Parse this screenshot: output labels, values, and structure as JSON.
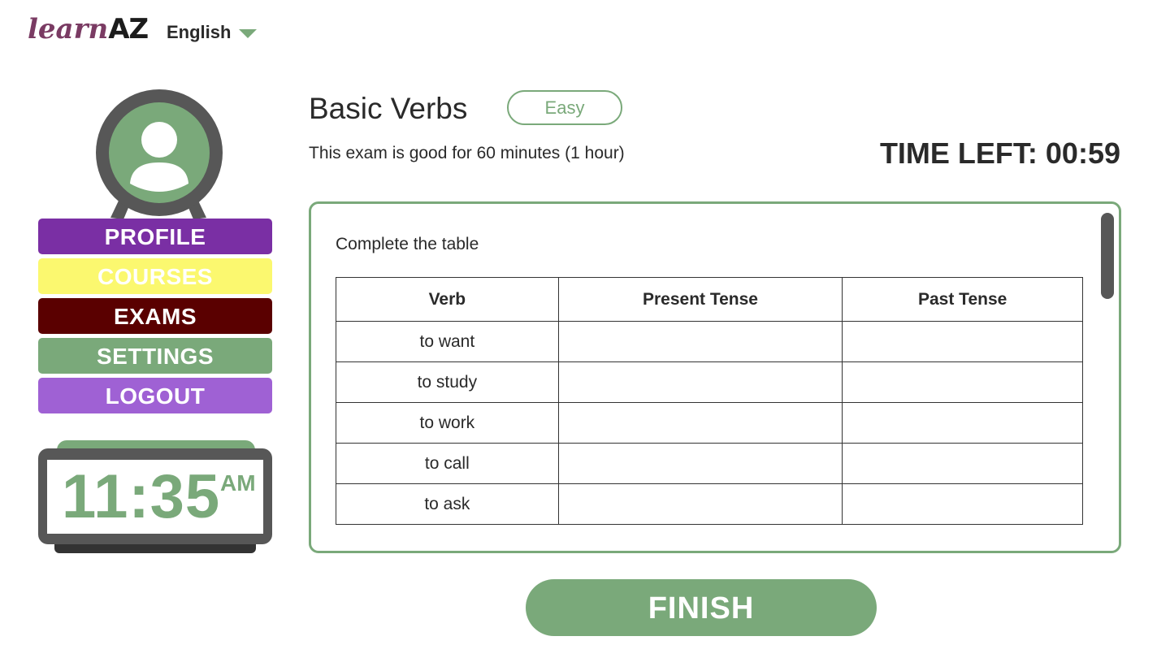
{
  "header": {
    "logo_part1": "learn",
    "logo_part2": "AZ",
    "language": "English"
  },
  "nav": {
    "items": [
      {
        "label": "PROFILE"
      },
      {
        "label": "COURSES"
      },
      {
        "label": "EXAMS"
      },
      {
        "label": "SETTINGS"
      },
      {
        "label": "LOGOUT"
      }
    ]
  },
  "clock": {
    "time": "11:35",
    "period": "AM"
  },
  "exam": {
    "title": "Basic Verbs",
    "difficulty": "Easy",
    "duration_note": "This exam is good for 60 minutes (1 hour)",
    "time_left": "TIME LEFT: 00:59",
    "instructions": "Complete the table",
    "table": {
      "headers": [
        "Verb",
        "Present Tense",
        "Past Tense"
      ],
      "rows": [
        {
          "verb": "to want",
          "present": "",
          "past": ""
        },
        {
          "verb": "to study",
          "present": "",
          "past": ""
        },
        {
          "verb": "to work",
          "present": "",
          "past": ""
        },
        {
          "verb": "to call",
          "present": "",
          "past": ""
        },
        {
          "verb": "to ask",
          "present": "",
          "past": ""
        }
      ]
    },
    "finish_label": "FINISH"
  },
  "colors": {
    "accent_green": "#7aa97a",
    "profile": "#7a2fa4",
    "courses": "#fbf86f",
    "exams": "#5a0000",
    "logout": "#9f61d4"
  }
}
